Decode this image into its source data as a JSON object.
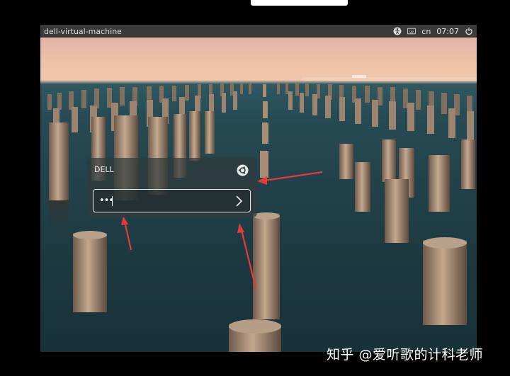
{
  "vm": {
    "topbar": {
      "hostname": "dell-virtual-machine",
      "keyboard_layout": "cn",
      "time": "07:07",
      "icons": [
        "accessibility-icon",
        "keyboard-icon",
        "power-icon"
      ]
    },
    "login": {
      "username": "DELL",
      "password_value": "•••",
      "session_icon": "ubuntu-session-icon",
      "submit_icon": "chevron-right-icon"
    }
  },
  "watermark": "知乎 @爱听歌的计科老师",
  "colors": {
    "annotation_arrow": "#e43a3a",
    "topbar_bg": "#3a3a38"
  }
}
